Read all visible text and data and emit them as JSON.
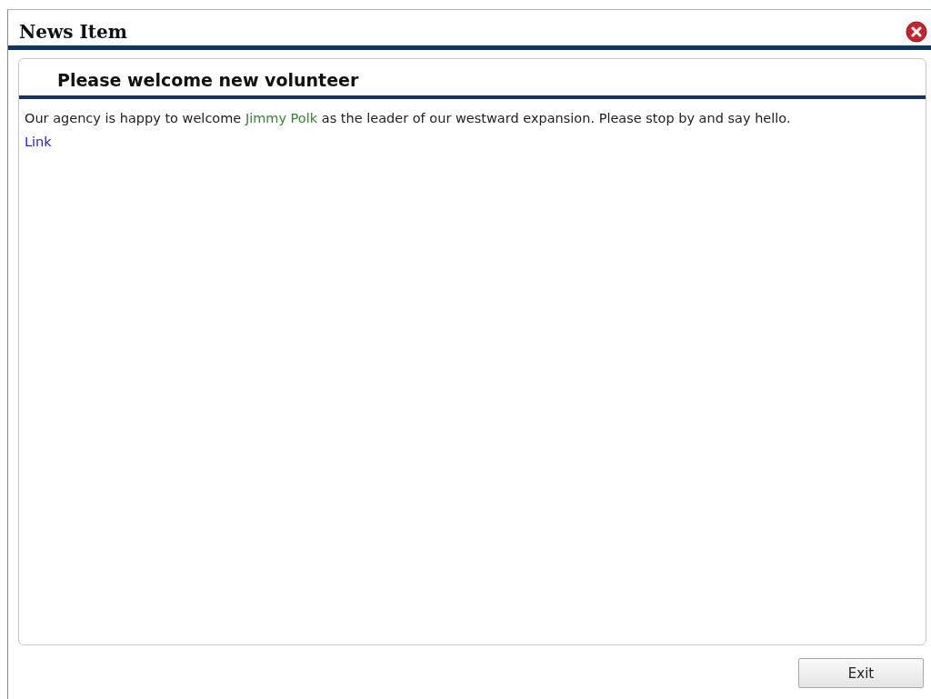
{
  "window": {
    "title": "News Item"
  },
  "news": {
    "heading": "Please welcome new volunteer",
    "body_before": "Our agency is happy to welcome ",
    "body_link": "Jimmy Polk",
    "body_after": " as the leader of our westward expansion. Please stop by and say hello.",
    "link": "Link"
  },
  "buttons": [
    {
      "label": "Exit"
    }
  ]
}
